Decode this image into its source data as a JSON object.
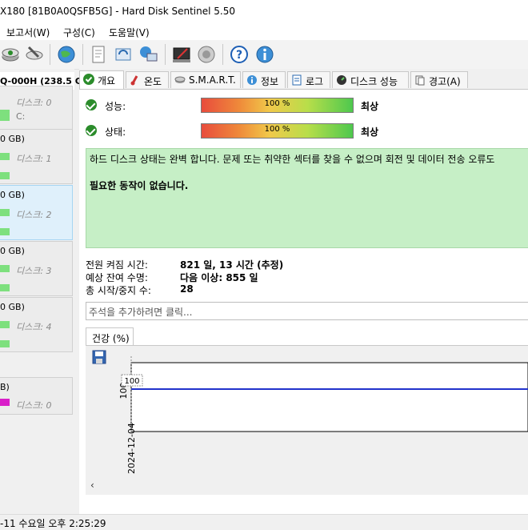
{
  "window": {
    "title": "X180 [81B0A0QSFB5G]  -  Hard Disk Sentinel 5.50"
  },
  "menu": [
    {
      "label": "보고서(W)"
    },
    {
      "label": "구성(C)"
    },
    {
      "label": "도움말(V)"
    }
  ],
  "toolbar": {
    "icons": [
      "disk-refresh-icon",
      "disk-test-icon",
      "globe-icon",
      "report-icon",
      "sync-icon",
      "network-icon",
      "settings-icon",
      "sound-icon",
      "help-icon",
      "info-icon"
    ]
  },
  "sidebar": {
    "header": "Q-000H (238.5 G",
    "disks": [
      {
        "capacity": "",
        "label": "디스크: 0",
        "drive": "C:"
      },
      {
        "capacity": "0 GB)",
        "label": "디스크: 1"
      },
      {
        "capacity": "0 GB)",
        "label": "디스크: 2"
      },
      {
        "capacity": "0 GB)",
        "label": "디스크: 3"
      },
      {
        "capacity": "0 GB)",
        "label": "디스크: 4"
      },
      {
        "capacity": "B)",
        "label": "디스크: 0"
      }
    ]
  },
  "tabs": [
    {
      "label": "개요",
      "icon": "check-icon"
    },
    {
      "label": "온도",
      "icon": "thermometer-icon"
    },
    {
      "label": "S.M.A.R.T.",
      "icon": "disk-icon"
    },
    {
      "label": "정보",
      "icon": "info-icon"
    },
    {
      "label": "로그",
      "icon": "document-icon"
    },
    {
      "label": "디스크 성능",
      "icon": "gauge-icon"
    },
    {
      "label": "경고(A)",
      "icon": "warning-icon"
    }
  ],
  "overview": {
    "performance": {
      "label": "성능:",
      "value": "100 %",
      "percent": 100,
      "grade": "최상"
    },
    "health": {
      "label": "상태:",
      "value": "100 %",
      "percent": 100,
      "grade": "최상"
    },
    "status_message": "하드 디스크 상태는 완벽 합니다. 문제 또는 취약한 섹터를 찾을 수 없으며 회전 및 데이터 전송 오류도",
    "action_message": "필요한 동작이 없습니다.",
    "power_on_label": "전원 켜짐 시간:",
    "power_on_value": "821 일, 13 시간 (추정)",
    "lifetime_label": "예상 잔여 수명:",
    "lifetime_value": "다음 이상: 855 일",
    "starts_label": "총 시작/중지 수:",
    "starts_value": "28",
    "note_placeholder": "주석을 추가하려면 클릭..."
  },
  "health_chart": {
    "tab_label": "건강 (%)",
    "save_icon": "save-icon"
  },
  "chart_data": {
    "type": "line",
    "x": [
      "2024-12-04"
    ],
    "series": [
      {
        "values": [
          100
        ]
      }
    ],
    "y_tick_label": "100",
    "data_label": "100",
    "line_color": "#2233cc"
  },
  "statusbar": {
    "text": "-11 수요일 오후 2:25:29"
  }
}
